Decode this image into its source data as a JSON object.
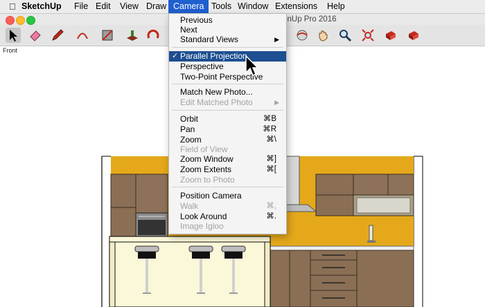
{
  "menubar": {
    "app": "SketchUp",
    "items": [
      "File",
      "Edit",
      "View",
      "Draw",
      "Camera",
      "Tools",
      "Window",
      "Extensions",
      "Help"
    ],
    "active": "Camera"
  },
  "window": {
    "title_fragment": "nUp Pro 2016"
  },
  "viewport": {
    "view_label": "Front"
  },
  "camera_menu": {
    "previous": "Previous",
    "next": "Next",
    "standard_views": "Standard Views",
    "parallel_projection": "Parallel Projection",
    "perspective": "Perspective",
    "two_point_perspective": "Two-Point Perspective",
    "match_new_photo": "Match New Photo...",
    "edit_matched_photo": "Edit Matched Photo",
    "orbit": {
      "label": "Orbit",
      "shortcut": "⌘B"
    },
    "pan": {
      "label": "Pan",
      "shortcut": "⌘R"
    },
    "zoom": {
      "label": "Zoom",
      "shortcut": "⌘\\"
    },
    "field_of_view": "Field of View",
    "zoom_window": {
      "label": "Zoom Window",
      "shortcut": "⌘]"
    },
    "zoom_extents": {
      "label": "Zoom Extents",
      "shortcut": "⌘["
    },
    "zoom_to_photo": "Zoom to Photo",
    "position_camera": "Position Camera",
    "walk": {
      "label": "Walk",
      "shortcut": "⌘,"
    },
    "look_around": {
      "label": "Look Around",
      "shortcut": "⌘."
    },
    "image_igloo": "Image Igloo",
    "checked_item": "Parallel Projection"
  },
  "colors": {
    "menu_highlight": "#1d4f91",
    "menubar_active": "#1f5fd0",
    "wall_yellow": "#e4a81a",
    "wood_cabinet": "#8a6f55",
    "counter_cream": "#fbf7d9"
  },
  "toolbar_icons": [
    "select-icon",
    "eraser-icon",
    "pencil-icon",
    "arc-icon",
    "rectangle-icon",
    "push-pull-icon",
    "rotate-icon",
    "offset-icon",
    "tape-measure-icon",
    "paint-bucket-icon",
    "orbit-icon",
    "pan-icon",
    "zoom-icon",
    "zoom-extents-icon",
    "previous-view-icon",
    "next-view-icon"
  ]
}
